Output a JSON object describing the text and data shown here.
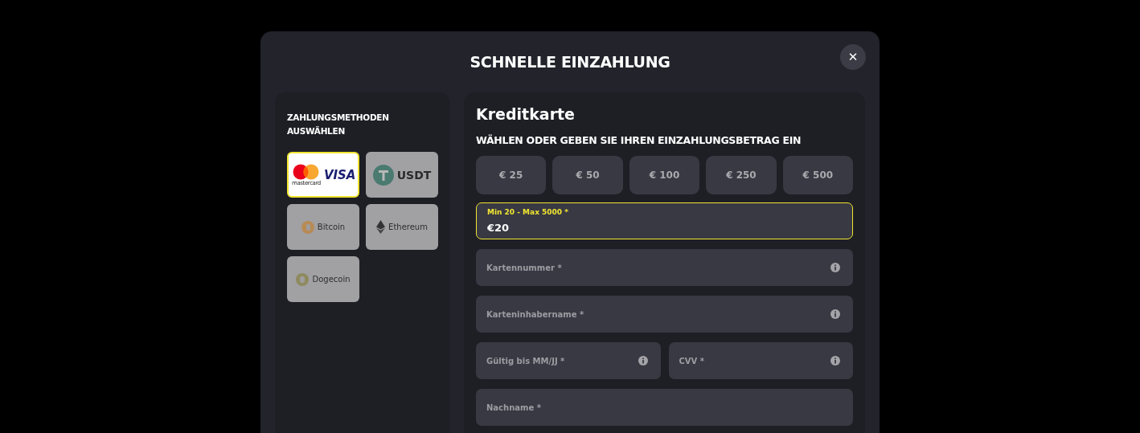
{
  "dialog": {
    "title": "SCHNELLE EINZAHLUNG",
    "close_label": "✕"
  },
  "methods_panel": {
    "heading": "ZAHLUNGSMETHODEN AUSWÄHLEN",
    "methods": [
      {
        "kind": "cards",
        "labels": [
          "mastercard",
          "VISA"
        ],
        "selected": true
      },
      {
        "kind": "usdt",
        "labels": [
          "USDT"
        ],
        "selected": false
      },
      {
        "kind": "bitcoin",
        "labels": [
          "Bitcoin"
        ],
        "selected": false
      },
      {
        "kind": "ethereum",
        "labels": [
          "Ethereum"
        ],
        "selected": false
      },
      {
        "kind": "dogecoin",
        "labels": [
          "Dogecoin"
        ],
        "selected": false
      }
    ]
  },
  "form": {
    "title": "Kreditkarte",
    "amount_heading": "WÄHLEN ODER GEBEN SIE IHREN EINZAHLUNGSBETRAG EIN",
    "amounts": [
      "€ 25",
      "€ 50",
      "€ 100",
      "€ 250",
      "€ 500"
    ],
    "amount_field": {
      "label": "Min 20 - Max 5000 *",
      "value": "€20",
      "focused": true
    },
    "fields": [
      {
        "placeholder": "Kartennummer *",
        "info": true,
        "half": false
      },
      {
        "placeholder": "Karteninhabername *",
        "info": true,
        "half": false
      },
      {
        "placeholder": "Gültig bis MM/JJ *",
        "info": true,
        "half": true
      },
      {
        "placeholder": "CVV *",
        "info": true,
        "half": true
      },
      {
        "placeholder": "Nachname *",
        "info": false,
        "half": false
      }
    ]
  }
}
